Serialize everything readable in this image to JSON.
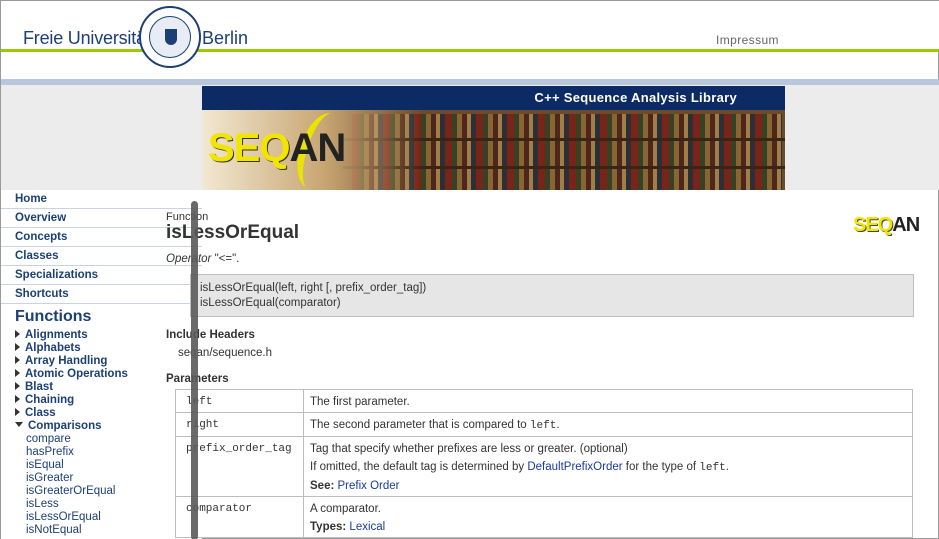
{
  "header": {
    "uni_left": "Freie Universität",
    "uni_right": "Berlin",
    "impressum": "Impressum"
  },
  "banner": {
    "title": "C++ Sequence Analysis Library",
    "logo_main": "SEQ",
    "logo_tail": "AN"
  },
  "sidebar": {
    "nav": [
      "Home",
      "Overview",
      "Concepts",
      "Classes",
      "Specializations",
      "Shortcuts"
    ],
    "functions_title": "Functions",
    "groups": [
      "Alignments",
      "Alphabets",
      "Array Handling",
      "Atomic Operations",
      "Blast",
      "Chaining",
      "Class"
    ],
    "open_group": "Comparisons",
    "leaves": [
      "compare",
      "hasPrefix",
      "isEqual",
      "isGreater",
      "isGreaterOrEqual",
      "isLess",
      "isLessOrEqual",
      "isNotEqual"
    ]
  },
  "content": {
    "kind": "Function",
    "title": "isLessOrEqual",
    "logo_main": "SEQ",
    "logo_tail": "AN",
    "desc_prefix": "Operator",
    "desc_rest": " \"<=\".",
    "sig1": "isLessOrEqual(left, right [, prefix_order_tag])",
    "sig2": "isLessOrEqual(comparator)",
    "include_heading": "Include Headers",
    "include_value": "seqan/sequence.h",
    "params_heading": "Parameters",
    "params": [
      {
        "name": "left",
        "desc": "The first parameter."
      },
      {
        "name": "right",
        "desc_pre": "The second parameter that is compared to ",
        "desc_code": "left",
        "desc_post": "."
      },
      {
        "name": "prefix_order_tag",
        "desc": "Tag that specify whether prefixes are less or greater. (optional)",
        "line2_pre": "If omitted, the default tag is determined by ",
        "line2_link": "DefaultPrefixOrder",
        "line2_mid": " for the type of ",
        "line2_code": "left",
        "line2_post": ".",
        "see_label": "See:",
        "see_link": "Prefix Order"
      },
      {
        "name": "comparator",
        "desc": "A comparator.",
        "types_label": "Types:",
        "types_link": "Lexical"
      }
    ]
  }
}
